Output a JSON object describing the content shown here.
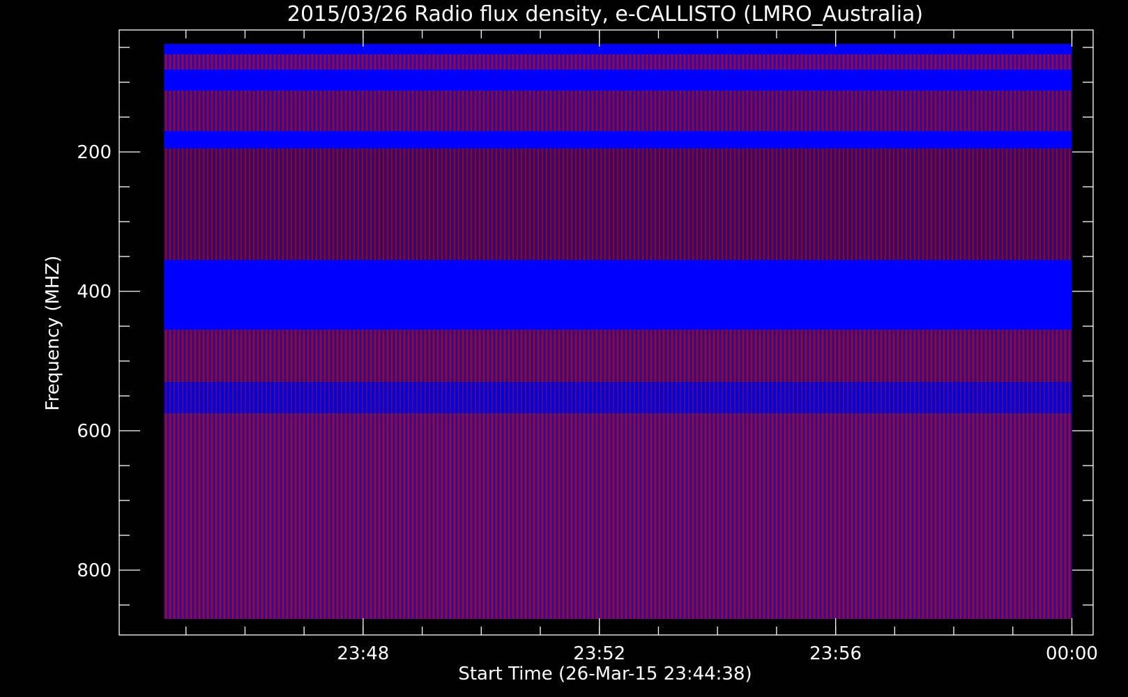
{
  "chart_data": {
    "type": "heatmap",
    "title": "2015/03/26  Radio flux density, e-CALLISTO (LMRO_Australia)",
    "xlabel": "Start Time (26-Mar-15 23:44:38)",
    "ylabel": "Frequency (MHZ)",
    "x_ticks": [
      "23:48",
      "23:52",
      "23:56",
      "00:00"
    ],
    "x_tick_minutes": [
      3.37,
      7.37,
      11.37,
      15.37
    ],
    "x_range_minutes": [
      -0.76,
      15.73
    ],
    "x_data_range_minutes": [
      0,
      15.37
    ],
    "y_ticks": [
      "200",
      "400",
      "600",
      "800"
    ],
    "y_tick_values": [
      200,
      400,
      600,
      800
    ],
    "y_range": [
      25,
      893
    ],
    "y_inverted": true,
    "y_data_range": [
      45,
      870
    ],
    "grid": false,
    "colormap": [
      "#000000",
      "#0000ff",
      "#8b0000",
      "#ff0000",
      "#ffff00",
      "#ffffff"
    ],
    "bands": [
      {
        "from": 45,
        "to": 60,
        "level": "high",
        "color": "#0000ff"
      },
      {
        "from": 60,
        "to": 82,
        "level": "mixed",
        "color": "#5a0b7a"
      },
      {
        "from": 82,
        "to": 112,
        "level": "high",
        "color": "#0000ff"
      },
      {
        "from": 112,
        "to": 170,
        "level": "mixed",
        "color": "#550b60"
      },
      {
        "from": 170,
        "to": 195,
        "level": "high",
        "color": "#0000ff"
      },
      {
        "from": 195,
        "to": 355,
        "level": "mixed",
        "color": "#4a0a40"
      },
      {
        "from": 355,
        "to": 455,
        "level": "high",
        "color": "#0000ff"
      },
      {
        "from": 455,
        "to": 530,
        "level": "mixed",
        "color": "#5a0e50"
      },
      {
        "from": 530,
        "to": 575,
        "level": "interference",
        "color": "#0000cc"
      },
      {
        "from": 575,
        "to": 870,
        "level": "mixed",
        "color": "#5c0f5a"
      }
    ]
  }
}
